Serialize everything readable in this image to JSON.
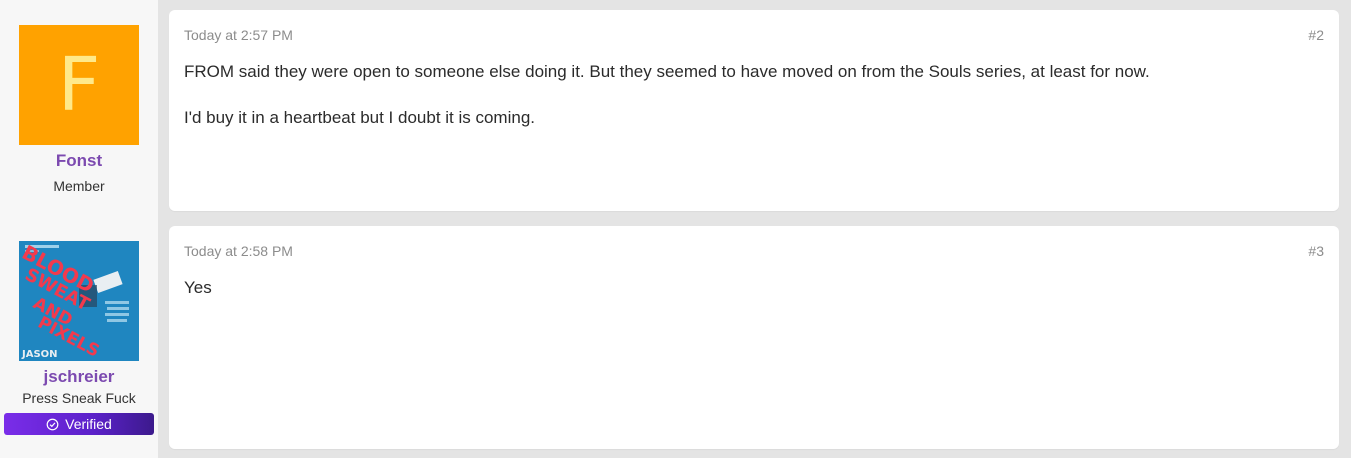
{
  "posts": [
    {
      "author": {
        "avatar_letter": "F",
        "name": "Fonst",
        "title": "Member"
      },
      "date": "Today at 2:57 PM",
      "number": "#2",
      "paragraphs": [
        "FROM said they were open to someone else doing it. But they seemed to have moved on from the Souls series, at least for now.",
        "I'd buy it in a heartbeat but I doubt it is coming."
      ]
    },
    {
      "author": {
        "avatar_image_words": [
          "BLOOD",
          "SWEAT",
          "AND",
          "PIXELS"
        ],
        "avatar_author_name": "JASON",
        "name": "jschreier",
        "title": "Press Sneak Fuck",
        "badge": "Verified"
      },
      "date": "Today at 2:58 PM",
      "number": "#3",
      "paragraphs": [
        "Yes"
      ]
    }
  ],
  "icons": {
    "verified": "check-circle-icon"
  },
  "colors": {
    "username": "#7c4ab0",
    "avatar_f_bg": "#ffa200",
    "avatar_f_fg": "#ffe98a",
    "verified_badge": "#7a2de9",
    "book_cover_bg": "#1f86c0",
    "book_cover_title": "#f23a4d"
  }
}
